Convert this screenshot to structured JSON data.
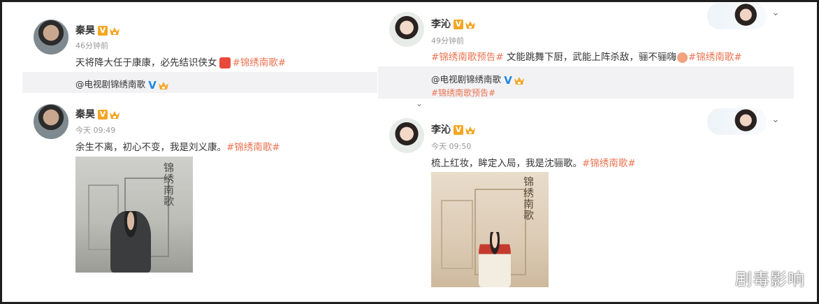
{
  "posts": [
    {
      "author": "秦昊",
      "time": "46分钟前",
      "text": "天将降大任于康康，必先结识侠女",
      "tag": "#锦绣南歌#",
      "repost_author": "@电视剧锦绣南歌"
    },
    {
      "author": "秦昊",
      "time": "今天 09:49",
      "text": "余生不离，初心不变，我是刘义康。",
      "tag": "#锦绣南歌#",
      "image_title": "锦绣南歌"
    },
    {
      "author": "李沁",
      "time": "49分钟前",
      "tag_prefix": "#锦绣南歌预告#",
      "text": " 文能跳舞下厨，武能上阵杀敌，骊不骊嗨",
      "tag": "#锦绣南歌#",
      "repost_author": "@电视剧锦绣南歌",
      "repost_text": "#锦绣南歌预告#"
    },
    {
      "author": "李沁",
      "time": "今天 09:50",
      "text": "梳上红妆，眸定入局，我是沈骊歌。",
      "tag": "#锦绣南歌#",
      "image_title": "锦绣南歌"
    }
  ],
  "icons": {
    "verified": "V",
    "member": "crown-icon",
    "chevron": "⌄"
  },
  "watermark": "剧毒影响",
  "colors": {
    "tag": "#eb7350",
    "badge": "#f5a623",
    "verified_blue": "#1e88e5",
    "repost_bg": "#f2f2f5"
  }
}
